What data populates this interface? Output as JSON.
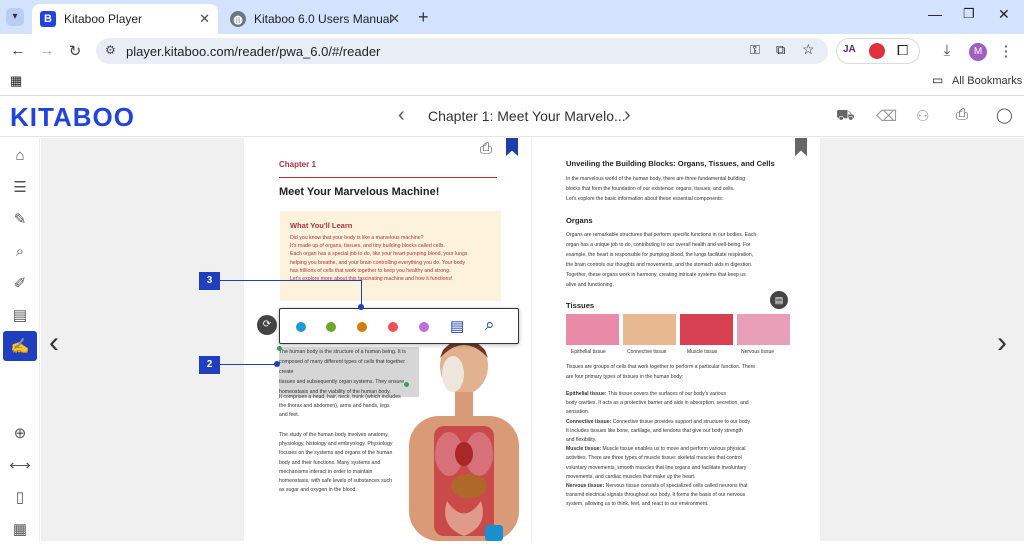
{
  "browser": {
    "tabs": [
      {
        "title": "Kitaboo Player"
      },
      {
        "title": "Kitaboo 6.0 Users Manual"
      }
    ],
    "url": "player.kitaboo.com/reader/pwa_6.0/#/reader",
    "bookmarks_label": "All Bookmarks",
    "profile_initial": "M"
  },
  "app": {
    "logo": "KITABOO",
    "chapter_title": "Chapter 1: Meet Your Marvelo..."
  },
  "left_page": {
    "chapter_label": "Chapter 1",
    "title": "Meet Your Marvelous Machine!",
    "learn_heading": "What You'll Learn",
    "learn_lines": [
      "Did you know that your body is like a marvelous machine?",
      "It's made up of organs, tissues, and tiny building blocks called cells.",
      "Each organ has a special job to do, like your heart pumping blood, your lungs",
      "helping you breathe, and your brain controlling everything you do. Your body",
      "has trillions of cells that work together to keep you healthy and strong.",
      "Let's explore more about this fascinating machine and how it functions!"
    ],
    "selected_lines": [
      "The human body is the structure of a human being. It is",
      "composed of many different types of cells that together create",
      "tissues and subsequently organ systems. They ensure",
      "homeostasis and the viability of the human body."
    ],
    "para2": [
      "It comprises a head, hair, neck, trunk (which includes",
      "the thorax and abdomen), arms and hands, legs",
      "and feet."
    ],
    "para3": [
      "The study of the human body involves anatomy,",
      "physiology, histology and embryology. Physiology",
      "focuses on the systems and organs of the human",
      "body and their functions. Many systems and",
      "mechanisms interact in order to maintain",
      "homeostasis, with safe levels of substances such",
      "as sugar and oxygen in the blood."
    ]
  },
  "right_page": {
    "title": "Unveiling the Building Blocks: Organs, Tissues, and Cells",
    "intro": [
      "In the marvelous world of the human body, there are three fundamental building",
      "blocks that form the foundation of our existence: organs, tissues, and cells.",
      "Let's explore the basic information about these essential components:"
    ],
    "organs_heading": "Organs",
    "organs_text": [
      "Organs are remarkable structures that perform specific functions in our bodies. Each",
      "organ has a unique job to do, contributing to our overall health and well-being. For",
      "example, the heart is responsible for pumping blood, the lungs facilitate respiration,",
      "the brain controls our thoughts and movements, and the stomach aids in digestion.",
      "Together, these organs work in harmony, creating intricate systems that keep us",
      "alive and functioning."
    ],
    "tissues_heading": "Tissues",
    "tissue_images": [
      {
        "caption": "Epithelial tissue",
        "color": "#e88aa8"
      },
      {
        "caption": "Connective tissue",
        "color": "#e8b890"
      },
      {
        "caption": "Muscle tissue",
        "color": "#d64050"
      },
      {
        "caption": "Nervous tissue",
        "color": "#e8a0b8"
      }
    ],
    "tissues_text": [
      "Tissues are groups of cells that work together to perform a particular function. There",
      "are four primary types of tissues in the human body:"
    ],
    "tissue_types": [
      {
        "name": "Epithelial tissue:",
        "text": "This tissue covers the surfaces of our body's various",
        "more": [
          "body cavities. It acts as a protective barrier and aids in absorption, secretion, and",
          "sensation."
        ]
      },
      {
        "name": "Connective tissue:",
        "text": "Connective tissue provides support and structure to our body.",
        "more": [
          "It includes tissues like bone, cartilage, and tendons that give our body strength",
          "and flexibility."
        ]
      },
      {
        "name": "Muscle tissue:",
        "text": "Muscle tissue enables us to move and perform various physical",
        "more": [
          "activities. There are three types of muscle tissue: skeletal muscles that control",
          "voluntary movements, smooth muscles that line organs and facilitate involuntary",
          "movements, and cardiac muscles that make up the heart."
        ]
      },
      {
        "name": "Nervous tissue:",
        "text": "Nervous tissue consists of specialized cells called neurons that",
        "more": [
          "transmit electrical signals throughout our body. It forms the basis of our nervous",
          "system, allowing us to think, feel, and react to our environment."
        ]
      }
    ]
  },
  "highlight_toolbar": {
    "colors": [
      "#1a9ad6",
      "#6aa829",
      "#d67a0a",
      "#f05050",
      "#c070e0"
    ]
  },
  "callouts": [
    "3",
    "2"
  ]
}
